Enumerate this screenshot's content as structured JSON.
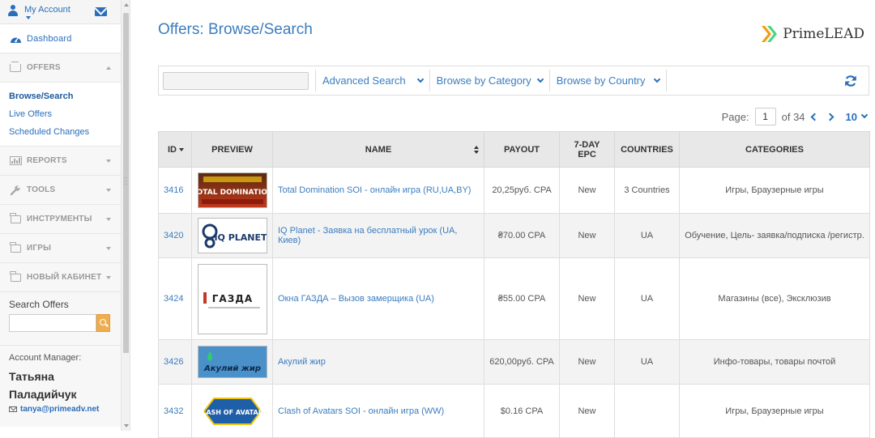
{
  "sidebar": {
    "account_label": "My Account",
    "dashboard": "Dashboard",
    "offers": "OFFERS",
    "offers_sub": [
      "Browse/Search",
      "Live Offers",
      "Scheduled Changes"
    ],
    "reports": "REPORTS",
    "tools": "TOOLS",
    "instruments": "ИНСТРУМЕНТЫ",
    "games": "ИГРЫ",
    "new_cabinet": "НОВЫЙ КАБИНЕТ",
    "search_title": "Search Offers",
    "search_value": "",
    "manager_title": "Account Manager:",
    "manager_first": "Татьяна",
    "manager_last": "Паладийчук",
    "manager_email": "tanya@primeadv.net"
  },
  "main": {
    "title": "Offers: Browse/Search",
    "logo_text": "PrimeLEAD",
    "filters": {
      "search_value": "",
      "advanced": "Advanced Search",
      "category": "Browse by Category",
      "country": "Browse by Country"
    },
    "pager": {
      "label": "Page:",
      "current": "1",
      "of": "of 34",
      "per_page": "10"
    },
    "columns": {
      "id": "ID",
      "preview": "PREVIEW",
      "name": "NAME",
      "payout": "PAYOUT",
      "epc_line1": "7-DAY",
      "epc_line2": "EPC",
      "countries": "COUNTRIES",
      "categories": "CATEGORIES"
    },
    "rows": [
      {
        "id": "3416",
        "preview": "TOTAL DOMINATION",
        "name": "Total Domination SOI - онлайн игра (RU,UA,BY)",
        "payout": "20,25руб. CPA",
        "epc": "New",
        "countries": "3 Countries",
        "categories": "Игры, Браузерные игры"
      },
      {
        "id": "3420",
        "preview": "IQ PLANET",
        "name": "IQ Planet - Заявка на бесплатный урок (UA, Киев)",
        "payout": "₴70.00 CPA",
        "epc": "New",
        "countries": "UA",
        "categories": "Обучение, Цель- заявка/подписка /регистр."
      },
      {
        "id": "3424",
        "preview": "ГАЗДА",
        "name": "Окна ГАЗДА – Вызов замерщика (UA)",
        "payout": "₴55.00 CPA",
        "epc": "New",
        "countries": "UA",
        "categories": "Магазины (все), Эксклюзив"
      },
      {
        "id": "3426",
        "preview": "Акулий жир",
        "name": "Акулий жир",
        "payout": "620,00руб. CPA",
        "epc": "New",
        "countries": "UA",
        "categories": "Инфо-товары, товары почтой"
      },
      {
        "id": "3432",
        "preview": "CLASH OF AVATARS",
        "name": "Clash of Avatars SOI - онлайн игра (WW)",
        "payout": "$0.16 CPA",
        "epc": "New",
        "countries": "",
        "categories": "Игры, Браузерные игры"
      }
    ]
  },
  "colors": {
    "accent": "#2a6ebb",
    "link": "#3b7dbf",
    "search_button": "#f0ad4e",
    "header_bg": "#e8e8e8"
  }
}
